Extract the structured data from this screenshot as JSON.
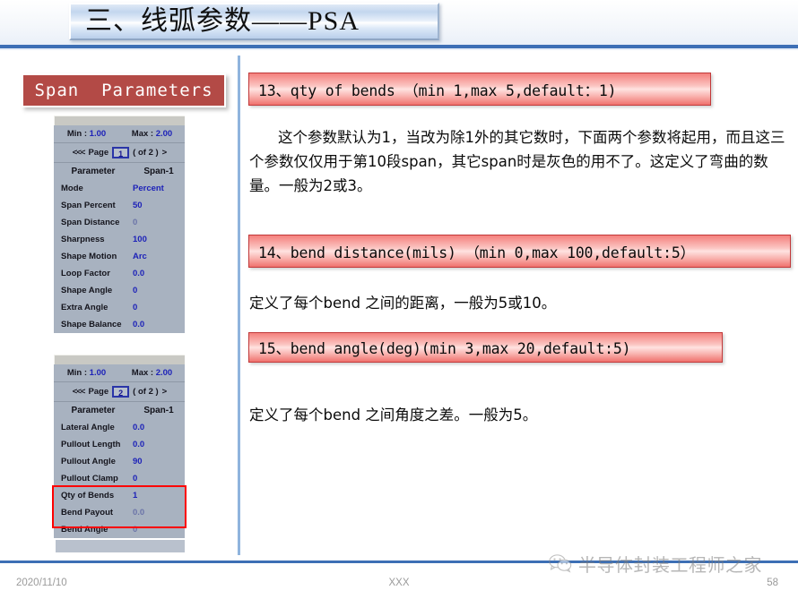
{
  "slide": {
    "title": "三、线弧参数——PSA",
    "accent_blue": "#3d6fb5",
    "banner_red": "#c1393a",
    "panel_gray": "#a8b2c0",
    "value_blue": "#1d22b8"
  },
  "span_panel": {
    "title": "Span  Parameters",
    "title_bg": "#b34a46",
    "tables": [
      {
        "min_label": "Min :",
        "min_value": "1.00",
        "max_label": "Max :",
        "max_value": "2.00",
        "page_prev": "<<<",
        "page_label": "Page",
        "page_value": "1",
        "page_of": "( of 2 )",
        "page_next": ">",
        "col_parameter": "Parameter",
        "col_span": "Span-1",
        "rows": [
          {
            "name": "Mode",
            "value": "Percent",
            "dim": false
          },
          {
            "name": "Span Percent",
            "value": "50",
            "dim": false
          },
          {
            "name": "Span Distance",
            "value": "0",
            "dim": true
          },
          {
            "name": "Sharpness",
            "value": "100",
            "dim": false
          },
          {
            "name": "Shape Motion",
            "value": "Arc",
            "dim": false
          },
          {
            "name": "Loop Factor",
            "value": "0.0",
            "dim": false
          },
          {
            "name": "Shape Angle",
            "value": "0",
            "dim": false
          },
          {
            "name": "Extra Angle",
            "value": "0",
            "dim": false
          },
          {
            "name": "Shape Balance",
            "value": "0.0",
            "dim": false
          }
        ]
      },
      {
        "min_label": "Min :",
        "min_value": "1.00",
        "max_label": "Max :",
        "max_value": "2.00",
        "page_prev": "<<<",
        "page_label": "Page",
        "page_value": "2",
        "page_of": "( of 2 )",
        "page_next": ">",
        "col_parameter": "Parameter",
        "col_span": "Span-1",
        "rows": [
          {
            "name": "Lateral Angle",
            "value": "0.0",
            "dim": false
          },
          {
            "name": "Pullout Length",
            "value": "0.0",
            "dim": false
          },
          {
            "name": "Pullout Angle",
            "value": "90",
            "dim": false
          },
          {
            "name": "Pullout Clamp",
            "value": "0",
            "dim": false
          },
          {
            "name": "Qty of Bends",
            "value": "1",
            "dim": false
          },
          {
            "name": "Bend Payout",
            "value": "0.0",
            "dim": true
          },
          {
            "name": "Bend Angle",
            "value": "0",
            "dim": true
          }
        ]
      }
    ],
    "highlight_color": "#ff0000"
  },
  "content": {
    "sections": [
      {
        "heading": "13、qty of bends （min 1,max 5,default：1)",
        "body": "这个参数默认为1，当改为除1外的其它数时，下面两个参数将起用，而且这三个参数仅仅用于第10段span，其它span时是灰色的用不了。这定义了弯曲的数量。一般为2或3。"
      },
      {
        "heading": "14、bend distance(mils) （min 0,max 100,default:5）",
        "body": "定义了每个bend 之间的距离，一般为5或10。"
      },
      {
        "heading": "15、bend angle(deg)(min 3,max 20,default:5)",
        "body": "定义了每个bend 之间角度之差。一般为5。"
      }
    ]
  },
  "footer": {
    "date": "2020/11/10",
    "center": "XXX",
    "page_number": "58",
    "watermark_text": "半导体封装工程师之家",
    "watermark_icon": "wechat-icon"
  }
}
